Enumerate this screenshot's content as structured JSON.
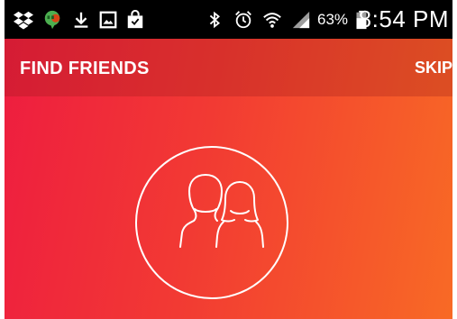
{
  "status_bar": {
    "notification_icons": [
      "dropbox-icon",
      "hangouts-icon",
      "download-icon",
      "gallery-icon",
      "shopping-bag-icon"
    ],
    "system_icons": [
      "bluetooth-icon",
      "alarm-icon",
      "wifi-icon",
      "signal-icon",
      "battery-icon"
    ],
    "battery_percent": "63%",
    "time": "8:54 PM"
  },
  "app_bar": {
    "title": "FIND FRIENDS",
    "skip_label": "SKIP"
  },
  "hero": {
    "icon": "friends-icon"
  },
  "colors": {
    "gradient_start": "#ee1c40",
    "gradient_end": "#f86a25",
    "status_bar_bg": "#000000",
    "foreground": "#ffffff"
  }
}
